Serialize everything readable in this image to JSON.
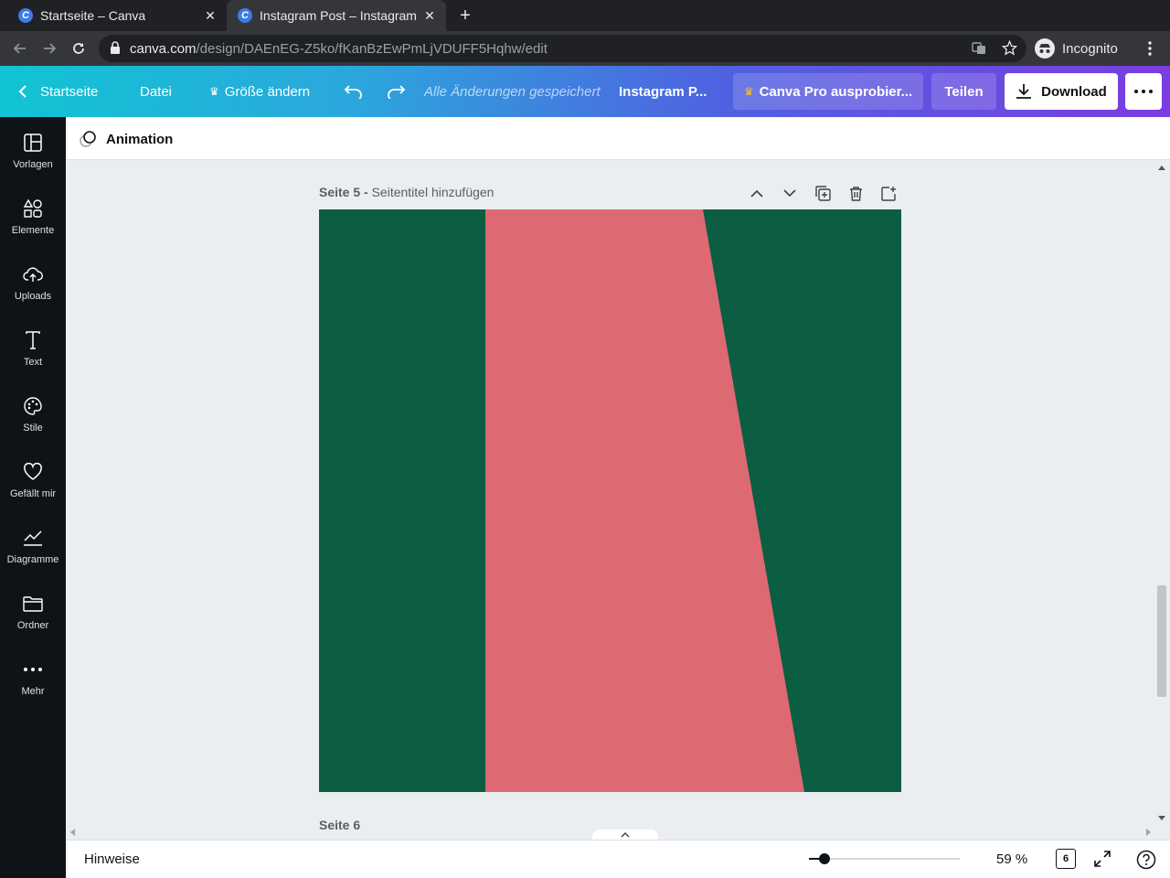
{
  "browser": {
    "tabs": [
      {
        "title": "Startseite – Canva",
        "favicon": "C"
      },
      {
        "title": "Instagram Post – Instagram",
        "favicon": "C"
      }
    ],
    "url_host": "canva.com",
    "url_path": "/design/DAEnEG-Z5ko/fKanBzEwPmLjVDUFF5Hqhw/edit",
    "profile": "Incognito"
  },
  "header": {
    "home": "Startseite",
    "file": "Datei",
    "resize": "Größe ändern",
    "saved": "Alle Änderungen gespeichert",
    "title": "Instagram P...",
    "pro": "Canva Pro ausprobier...",
    "share": "Teilen",
    "download": "Download"
  },
  "sidebar": {
    "items": [
      {
        "label": "Vorlagen",
        "icon": "templates-icon"
      },
      {
        "label": "Elemente",
        "icon": "elements-icon"
      },
      {
        "label": "Uploads",
        "icon": "upload-cloud-icon"
      },
      {
        "label": "Text",
        "icon": "text-icon"
      },
      {
        "label": "Stile",
        "icon": "palette-icon"
      },
      {
        "label": "Gefällt mir",
        "icon": "heart-icon"
      },
      {
        "label": "Diagramme",
        "icon": "chart-icon"
      },
      {
        "label": "Ordner",
        "icon": "folder-icon"
      },
      {
        "label": "Mehr",
        "icon": "more-dots-icon"
      }
    ]
  },
  "toolbar": {
    "animation": "Animation"
  },
  "page": {
    "label": "Seite 5 -",
    "title_placeholder": "Seitentitel hinzufügen",
    "next_label": "Seite 6"
  },
  "design_colors": {
    "green": "#0b5e42",
    "pink": "#dd6973"
  },
  "footer": {
    "notes": "Hinweise",
    "zoom": "59 %",
    "zoom_level": 0.1,
    "page_count": "6"
  }
}
